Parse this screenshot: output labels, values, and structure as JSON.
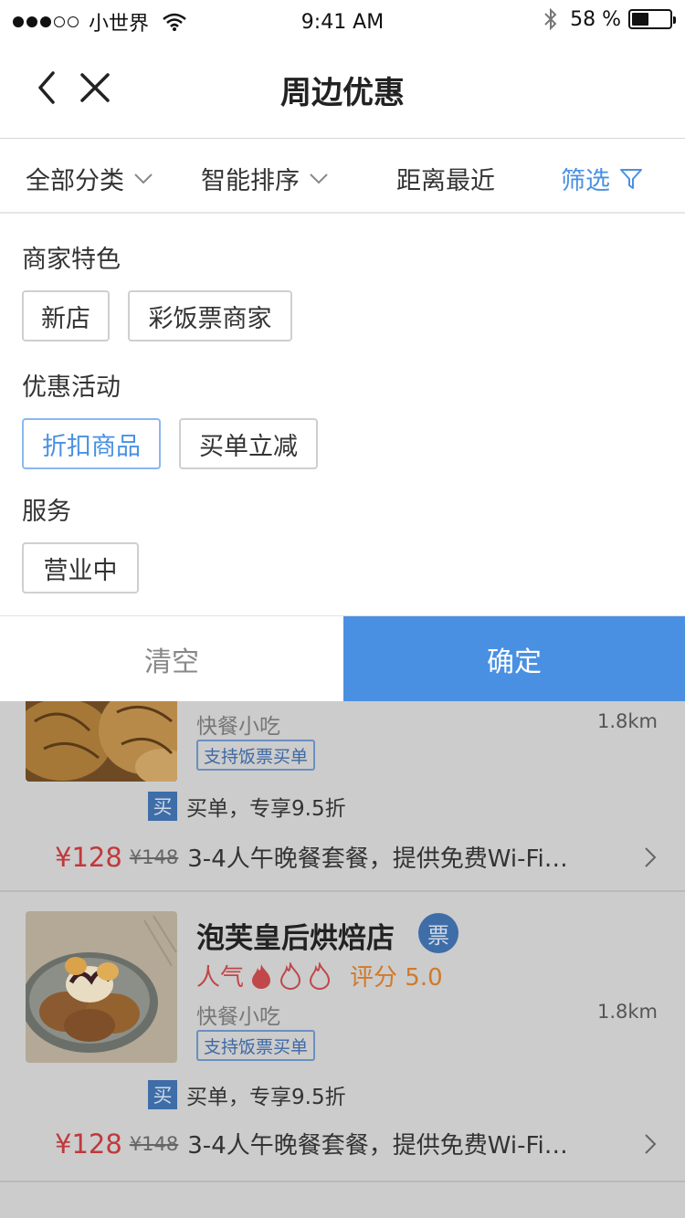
{
  "status_bar": {
    "carrier": "小世界",
    "time": "9:41 AM",
    "battery_pct": "58 %",
    "battery_level": 0.45
  },
  "nav": {
    "title": "周边优惠",
    "back_icon": "chevron-left-icon",
    "close_icon": "close-icon"
  },
  "filter_bar": {
    "category": "全部分类",
    "sort": "智能排序",
    "distance": "距离最近",
    "filter": "筛选"
  },
  "panel": {
    "sections": [
      {
        "title": "商家特色",
        "tags": [
          {
            "label": "新店",
            "selected": false
          },
          {
            "label": "彩饭票商家",
            "selected": false
          }
        ]
      },
      {
        "title": "优惠活动",
        "tags": [
          {
            "label": "折扣商品",
            "selected": true
          },
          {
            "label": "买单立减",
            "selected": false
          }
        ]
      },
      {
        "title": "服务",
        "tags": [
          {
            "label": "营业中",
            "selected": false
          }
        ]
      }
    ],
    "clear_label": "清空",
    "confirm_label": "确定"
  },
  "colors": {
    "accent": "#4a90e2",
    "overlay": "#cccccc",
    "price": "#c0393b",
    "rating": "#d07a2a"
  },
  "list": {
    "items": [
      {
        "name": "",
        "category": "快餐小吃",
        "distance": "1.8km",
        "support": "支持饭票买单",
        "buy_icon": "买",
        "buy_text": "买单，专享9.5折",
        "price": "¥128",
        "original_price": "¥148",
        "deal": "3-4人午晚餐套餐，提供免费Wi-Fi…"
      },
      {
        "name": "泡芙皇后烘焙店",
        "ticket_badge": "票",
        "popularity_label": "人气",
        "popularity_flames": 3,
        "rating": "评分 5.0",
        "category": "快餐小吃",
        "distance": "1.8km",
        "support": "支持饭票买单",
        "buy_icon": "买",
        "buy_text": "买单，专享9.5折",
        "price": "¥128",
        "original_price": "¥148",
        "deal": "3-4人午晚餐套餐，提供免费Wi-Fi…"
      }
    ]
  }
}
